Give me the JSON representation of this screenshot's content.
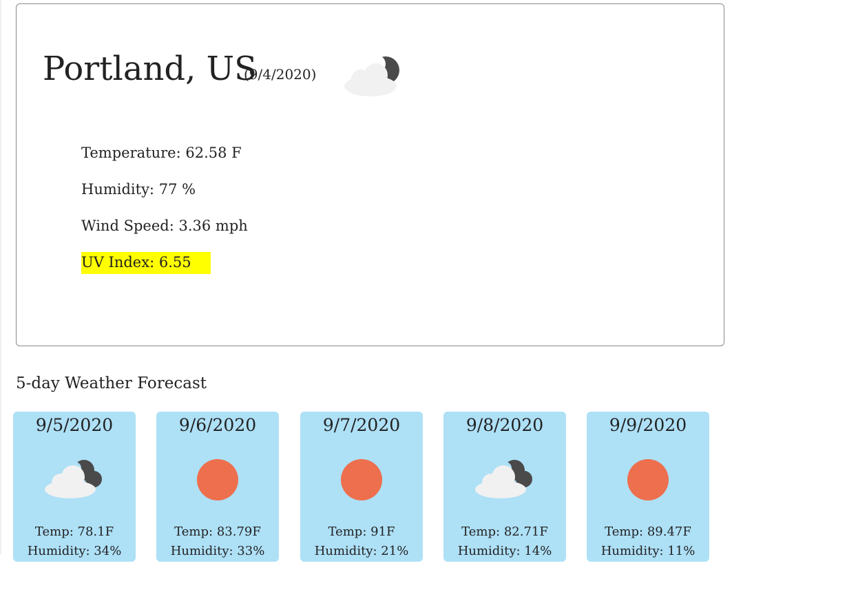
{
  "current": {
    "city": "Portland, US",
    "date": "(9/4/2020)",
    "icon": "night-cloud-icon",
    "temperature_label": "Temperature:",
    "temperature_value": "62.58 F",
    "humidity_label": "Humidity:",
    "humidity_value": "77 %",
    "wind_label": "Wind Speed:",
    "wind_value": "3.36 mph",
    "uv_label": "UV Index:",
    "uv_value": "6.55",
    "uv_highlight_color": "#ffff00"
  },
  "forecast": {
    "heading": "5-day Weather Forecast",
    "card_color": "#aee0f6",
    "temp_label": "Temp:",
    "humidity_label": "Humidity:",
    "days": [
      {
        "date": "9/5/2020",
        "icon": "night-cloud-icon",
        "temp": "78.1F",
        "humidity": "34%"
      },
      {
        "date": "9/6/2020",
        "icon": "sun-icon",
        "temp": "83.79F",
        "humidity": "33%"
      },
      {
        "date": "9/7/2020",
        "icon": "sun-icon",
        "temp": "91F",
        "humidity": "21%"
      },
      {
        "date": "9/8/2020",
        "icon": "night-cloud-icon",
        "temp": "82.71F",
        "humidity": "14%"
      },
      {
        "date": "9/9/2020",
        "icon": "sun-icon",
        "temp": "89.47F",
        "humidity": "11%"
      }
    ]
  }
}
